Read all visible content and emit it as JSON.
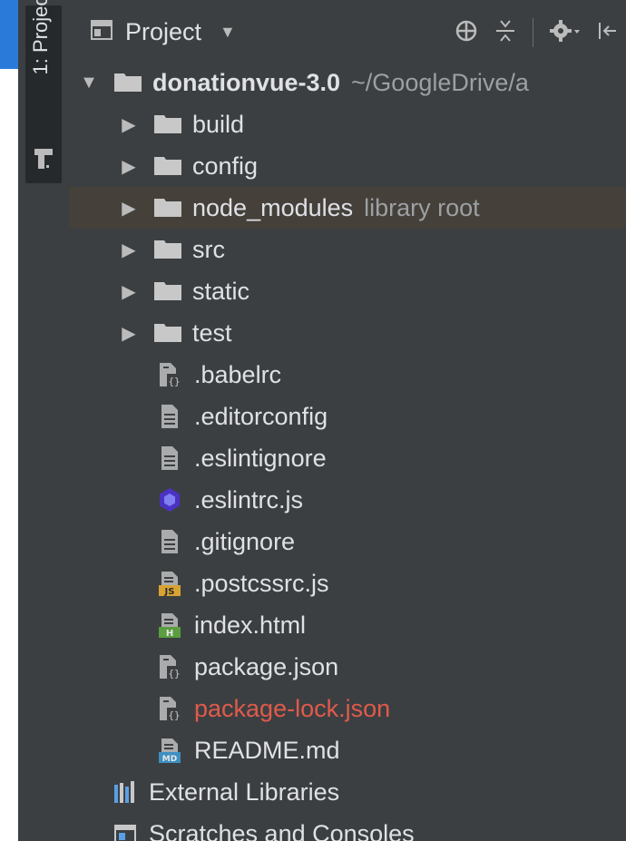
{
  "tool_window": {
    "tab_label": "1: Project"
  },
  "header": {
    "title": "Project"
  },
  "tree": {
    "root": {
      "name": "donationvue-3.0",
      "path": "~/GoogleDrive/a"
    },
    "folders": [
      {
        "name": "build"
      },
      {
        "name": "config"
      },
      {
        "name": "node_modules",
        "suffix": "library root"
      },
      {
        "name": "src"
      },
      {
        "name": "static"
      },
      {
        "name": "test"
      }
    ],
    "files": [
      {
        "name": ".babelrc",
        "icon": "json-config-icon"
      },
      {
        "name": ".editorconfig",
        "icon": "text-file-icon"
      },
      {
        "name": ".eslintignore",
        "icon": "text-file-icon"
      },
      {
        "name": ".eslintrc.js",
        "icon": "eslint-icon"
      },
      {
        "name": ".gitignore",
        "icon": "text-file-icon"
      },
      {
        "name": ".postcssrc.js",
        "icon": "js-file-icon",
        "badge": "JS"
      },
      {
        "name": "index.html",
        "icon": "html-file-icon",
        "badge": "H"
      },
      {
        "name": "package.json",
        "icon": "json-config-icon"
      },
      {
        "name": "package-lock.json",
        "icon": "json-config-icon",
        "status_color": "#e05a4c"
      },
      {
        "name": "README.md",
        "icon": "markdown-file-icon",
        "badge": "MD"
      }
    ],
    "extras": [
      {
        "name": "External Libraries",
        "icon": "libraries-icon"
      },
      {
        "name": "Scratches and Consoles",
        "icon": "scratches-icon"
      }
    ]
  }
}
